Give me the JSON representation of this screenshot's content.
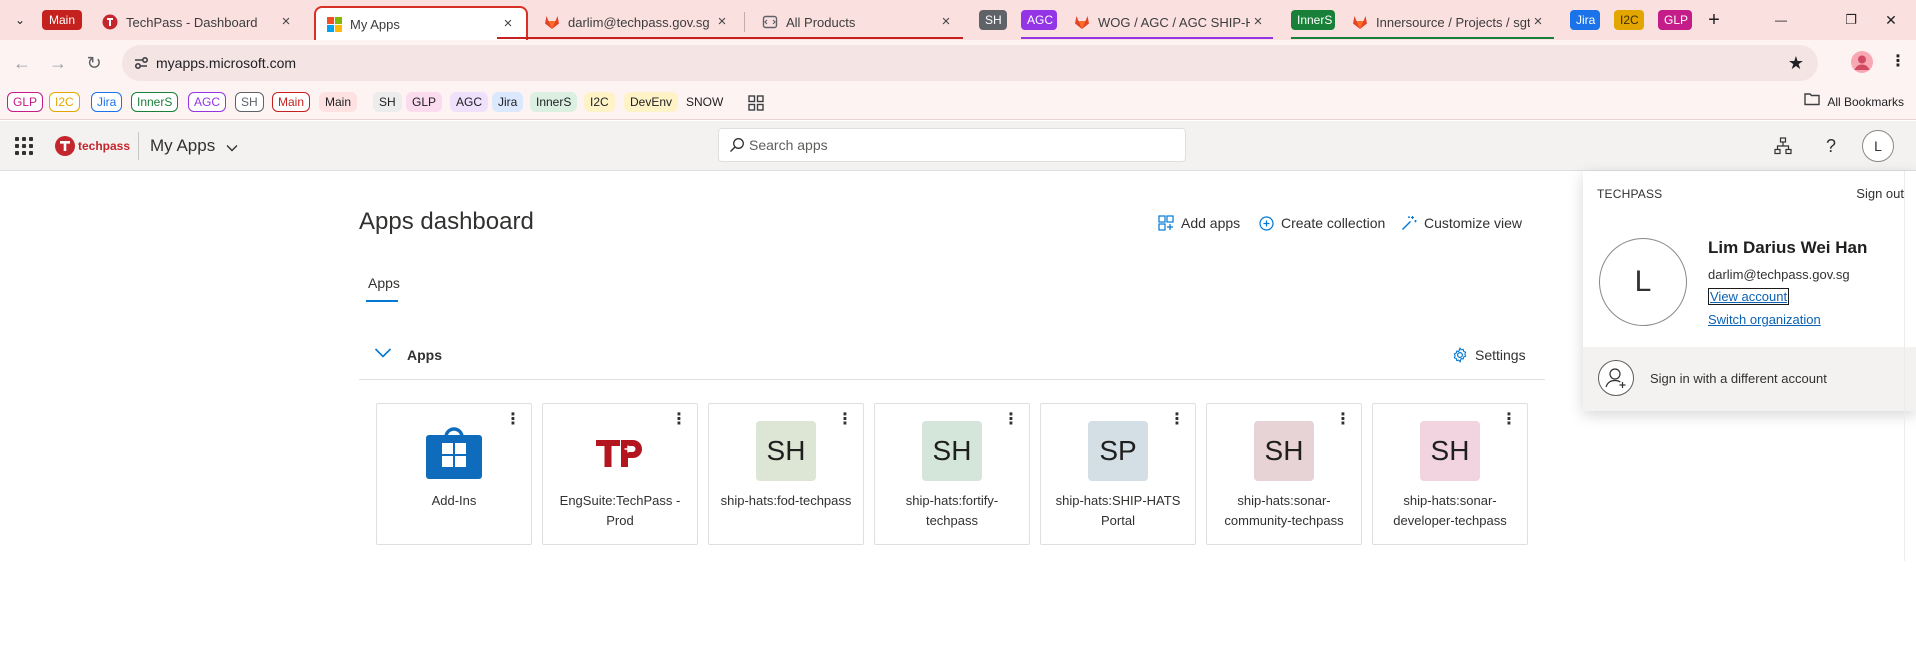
{
  "colors": {
    "main": "#c5221f",
    "i2c": "#e3a600",
    "jira": "#1a73e8",
    "inners": "#188038",
    "agc": "#9334e6",
    "sh": "#5f6368",
    "glp": "#c41c88",
    "brand": "#c4262e",
    "accent": "#0078d4"
  },
  "browser": {
    "tabs": [
      {
        "kind": "group-chip",
        "label": "Main"
      },
      {
        "kind": "tab",
        "title": "TechPass - Dashboard",
        "icon": "techpass-icon"
      },
      {
        "kind": "tab",
        "title": "My Apps",
        "icon": "microsoft-icon",
        "active": true
      },
      {
        "kind": "tab",
        "title": "darlim@techpass.gov.sg · SS",
        "icon": "gitlab-icon"
      },
      {
        "kind": "tab",
        "title": "All Products",
        "icon": "app-icon"
      },
      {
        "kind": "group-chip",
        "label": "SH"
      },
      {
        "kind": "group-chip",
        "label": "AGC"
      },
      {
        "kind": "tab",
        "title": "WOG / AGC / AGC SHIP-HATS",
        "icon": "gitlab-icon"
      },
      {
        "kind": "group-chip",
        "label": "InnerS"
      },
      {
        "kind": "tab",
        "title": "Innersource / Projects / sgts",
        "icon": "gitlab-icon"
      },
      {
        "kind": "group-chip",
        "label": "Jira"
      },
      {
        "kind": "group-chip",
        "label": "I2C"
      },
      {
        "kind": "group-chip",
        "label": "GLP"
      }
    ],
    "close_glyph": "×",
    "new_tab_glyph": "+",
    "window": {
      "minimize": "—",
      "restore": "❐",
      "close": "✕"
    },
    "url": "myapps.microsoft.com",
    "bookmarks": [
      {
        "label": "GLP",
        "style": "chip",
        "color": "glp"
      },
      {
        "label": "I2C",
        "style": "chip",
        "color": "i2c"
      },
      {
        "label": "Jira",
        "style": "chip",
        "color": "jira"
      },
      {
        "label": "InnerS",
        "style": "chip",
        "color": "inners"
      },
      {
        "label": "AGC",
        "style": "chip",
        "color": "agc"
      },
      {
        "label": "SH",
        "style": "chip",
        "color": "sh"
      },
      {
        "label": "Main",
        "style": "chip",
        "color": "main"
      },
      {
        "label": "Main",
        "style": "tinted",
        "color": "main"
      },
      {
        "label": "SH",
        "style": "tinted",
        "color": "sh"
      },
      {
        "label": "GLP",
        "style": "tinted",
        "color": "glp"
      },
      {
        "label": "AGC",
        "style": "tinted",
        "color": "agc"
      },
      {
        "label": "Jira",
        "style": "tinted",
        "color": "jira"
      },
      {
        "label": "InnerS",
        "style": "tinted",
        "color": "inners"
      },
      {
        "label": "I2C",
        "style": "tinted",
        "color": "i2c"
      },
      {
        "label": "DevEnv",
        "style": "tinted",
        "color": "i2c"
      },
      {
        "label": "SNOW",
        "style": "text",
        "color": "sh"
      }
    ],
    "all_bookmarks": "All Bookmarks"
  },
  "header": {
    "brand": "techpass",
    "title": "My Apps",
    "search_placeholder": "Search apps",
    "avatar_initial": "L"
  },
  "main": {
    "title": "Apps dashboard",
    "commands": {
      "add_apps": "Add apps",
      "create_collection": "Create collection",
      "customize_view": "Customize view"
    },
    "pivot": "Apps",
    "section": {
      "title": "Apps",
      "settings": "Settings"
    },
    "kebab_glyph": "⋮",
    "apps": [
      {
        "name": "Add-Ins",
        "tile": "store"
      },
      {
        "name": "EngSuite:TechPass - Prod",
        "tile": "techpass"
      },
      {
        "name": "ship-hats:fod-techpass",
        "initials": "SH",
        "bg": "#dde5d5"
      },
      {
        "name": "ship-hats:fortify-techpass",
        "initials": "SH",
        "bg": "#d3e6d9"
      },
      {
        "name": "ship-hats:SHIP-HATS Portal",
        "initials": "SP",
        "bg": "#d4dfe5"
      },
      {
        "name": "ship-hats:sonar-community-techpass",
        "initials": "SH",
        "bg": "#e7d2d5"
      },
      {
        "name": "ship-hats:sonar-developer-techpass",
        "initials": "SH",
        "bg": "#f1d4df"
      }
    ]
  },
  "account": {
    "org": "TECHPASS",
    "sign_out": "Sign out",
    "initial": "L",
    "name": "Lim Darius Wei Han",
    "email": "darlim@techpass.gov.sg",
    "view_account": "View account",
    "switch_org": "Switch organization",
    "different_account": "Sign in with a different account"
  }
}
